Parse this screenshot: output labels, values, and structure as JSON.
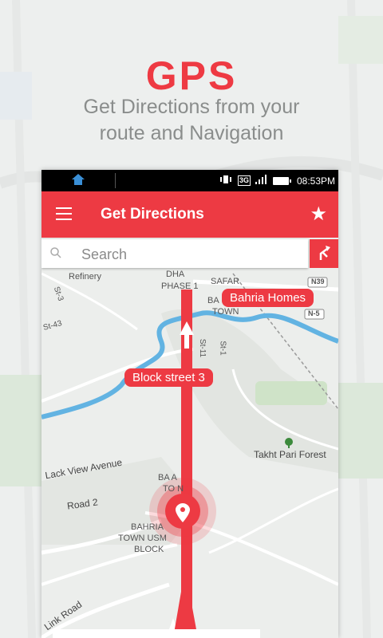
{
  "promo": {
    "title": "GPS",
    "subtitle_line1": "Get Directions from your",
    "subtitle_line2": "route and Navigation"
  },
  "statusbar": {
    "network": "3G",
    "time": "08:53PM",
    "icons": [
      "home-icon",
      "vibrate-icon",
      "signal-icon",
      "battery-icon"
    ]
  },
  "appbar": {
    "title": "Get Directions",
    "menu_icon": "hamburger-menu-icon",
    "favorite_icon": "star-icon"
  },
  "search": {
    "placeholder": "Search",
    "value": ""
  },
  "map": {
    "callouts": {
      "destination": "Bahria Homes",
      "waypoint": "Block street 3"
    },
    "labels": {
      "refinery": "Refinery",
      "dha": "DHA",
      "phase": "PHASE 1",
      "safari": "SAFAR",
      "bahria_town_top": "BA",
      "bahria_town_top2": "TOWN",
      "n39": "N39",
      "n5": "N-5",
      "st3": "St-3",
      "st43": "St-43",
      "st11": "St-11",
      "st1": "St-1",
      "takht_pari": "Takht Pari Forest",
      "lack_view": "Lack View Avenue",
      "road2": "Road 2",
      "bahria_mid1": "BA      A",
      "bahria_mid2": "TO   N",
      "bahria_block1": "BAHRIA",
      "bahria_block2": "TOWN USM",
      "bahria_block3": "BLOCK",
      "link_road": "Link Road"
    },
    "route_color": "#ed3a43",
    "accent": "#ed3a43"
  }
}
